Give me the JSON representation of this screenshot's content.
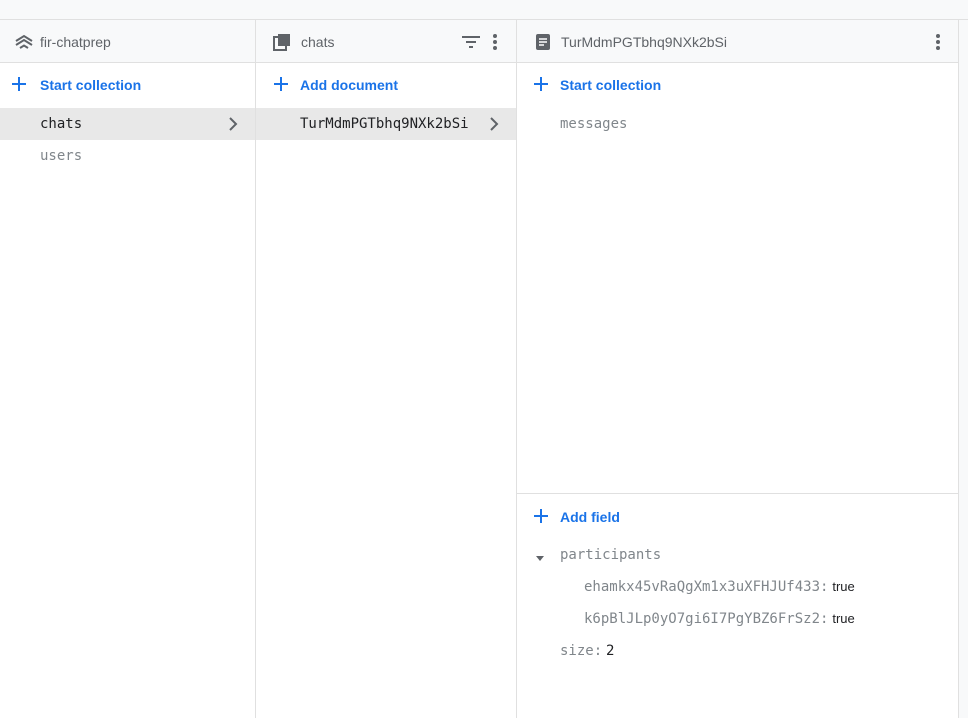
{
  "panels": {
    "root": {
      "title": "fir-chatprep",
      "icon": "firestore-root-icon",
      "add_label": "Start collection",
      "items": [
        {
          "label": "chats",
          "selected": true
        },
        {
          "label": "users",
          "selected": false
        }
      ]
    },
    "collection": {
      "title": "chats",
      "icon": "collection-icon",
      "add_label": "Add document",
      "items": [
        {
          "label": "TurMdmPGTbhq9NXk2bSi",
          "selected": true
        }
      ]
    },
    "document": {
      "title": "TurMdmPGTbhq9NXk2bSi",
      "icon": "document-icon",
      "add_collection_label": "Start collection",
      "subcollections": [
        {
          "label": "messages"
        }
      ],
      "add_field_label": "Add field",
      "fields": {
        "participants": {
          "key": "participants",
          "entries": [
            {
              "key": "ehamkx45vRaQgXm1x3uXFHJUf433:",
              "value": "true"
            },
            {
              "key": "k6pBlJLp0yO7gi6I7PgYBZ6FrSz2:",
              "value": "true"
            }
          ]
        },
        "size": {
          "key": "size:",
          "value": "2"
        }
      }
    }
  },
  "colors": {
    "accent": "#1a73e8",
    "header_bg": "#f8f9fa",
    "selected_bg": "#e8e8e8",
    "border": "#e0e0e0",
    "muted_text": "#80868b"
  }
}
